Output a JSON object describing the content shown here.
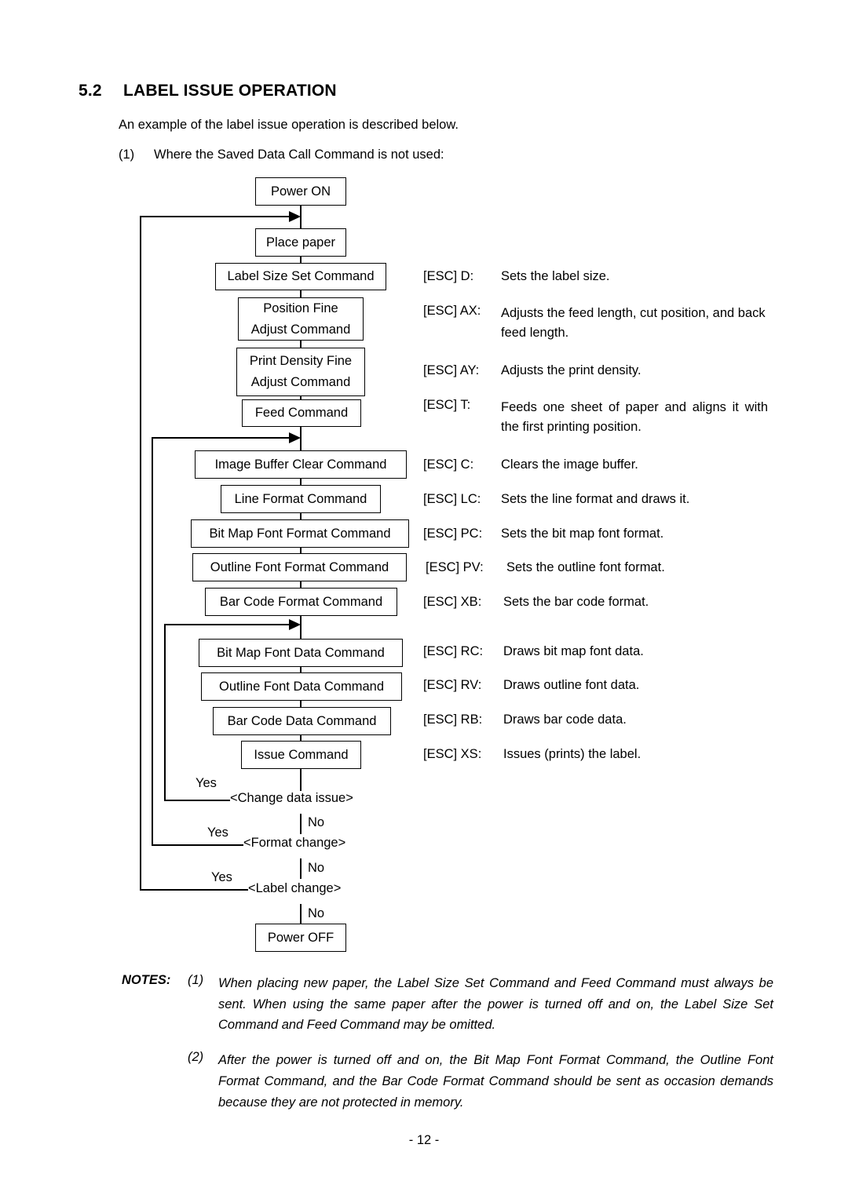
{
  "heading": {
    "number": "5.2",
    "title": "LABEL ISSUE OPERATION"
  },
  "intro": "An example of the label issue operation is described below.",
  "case": {
    "marker": "(1)",
    "text": "Where the Saved Data Call Command is not used:"
  },
  "flowchart": {
    "boxes": [
      {
        "id": "power-on",
        "label": "Power ON"
      },
      {
        "id": "place-paper",
        "label": "Place paper"
      },
      {
        "id": "label-size-set",
        "label": "Label Size Set Command"
      },
      {
        "id": "position-fine-adjust",
        "line1": "Position Fine",
        "line2": "Adjust Command"
      },
      {
        "id": "print-density-fine-adjust",
        "line1": "Print Density Fine",
        "line2": "Adjust Command"
      },
      {
        "id": "feed",
        "label": "Feed Command"
      },
      {
        "id": "image-buffer-clear",
        "label": "Image Buffer Clear Command"
      },
      {
        "id": "line-format",
        "label": "Line Format Command"
      },
      {
        "id": "bit-map-font-format",
        "label": "Bit Map Font Format Command"
      },
      {
        "id": "outline-font-format",
        "label": "Outline Font Format Command"
      },
      {
        "id": "bar-code-format",
        "label": "Bar Code Format Command"
      },
      {
        "id": "bit-map-font-data",
        "label": "Bit Map Font Data Command"
      },
      {
        "id": "outline-font-data",
        "label": "Outline Font Data Command"
      },
      {
        "id": "bar-code-data",
        "label": "Bar Code Data Command"
      },
      {
        "id": "issue",
        "label": "Issue Command"
      },
      {
        "id": "power-off",
        "label": "Power OFF"
      }
    ],
    "decisions": [
      {
        "id": "change-data-issue",
        "label": "<Change data issue>",
        "yes": "Yes",
        "no": "No"
      },
      {
        "id": "format-change",
        "label": "<Format change>",
        "yes": "Yes",
        "no": "No"
      },
      {
        "id": "label-change",
        "label": "<Label change>",
        "yes": "Yes",
        "no": "No"
      }
    ],
    "final_no": "No"
  },
  "commands": [
    {
      "code": "[ESC] D:",
      "desc": "Sets the label size."
    },
    {
      "code": "[ESC] AX:",
      "desc": "Adjusts the feed length, cut position, and back feed length."
    },
    {
      "code": "[ESC] AY:",
      "desc": "Adjusts the print density."
    },
    {
      "code": "[ESC] T:",
      "desc": "Feeds one sheet of paper and aligns it with the first printing position."
    },
    {
      "code": "[ESC] C:",
      "desc": "Clears the image buffer."
    },
    {
      "code": "[ESC] LC:",
      "desc": "Sets the line format and draws it."
    },
    {
      "code": "[ESC] PC:",
      "desc": "Sets the bit map font format."
    },
    {
      "code": "[ESC] PV:",
      "desc": "Sets the outline font format."
    },
    {
      "code": "[ESC] XB:",
      "desc": "Sets the bar code format."
    },
    {
      "code": "[ESC] RC:",
      "desc": "Draws bit map font data."
    },
    {
      "code": "[ESC] RV:",
      "desc": "Draws outline font data."
    },
    {
      "code": "[ESC] RB:",
      "desc": "Draws bar code data."
    },
    {
      "code": "[ESC] XS:",
      "desc": "Issues (prints) the label."
    }
  ],
  "notes": {
    "label": "NOTES:",
    "items": [
      {
        "index": "(1)",
        "text": "When placing new paper, the Label Size Set Command and Feed Command must always be sent.  When using the same paper after the power is turned off and on, the Label Size Set Command and Feed Command may be omitted."
      },
      {
        "index": "(2)",
        "text": "After the power is turned off and on, the Bit Map Font Format Command, the Outline Font Format Command, and the Bar Code Format Command should be sent as occasion demands because they are not protected in memory."
      }
    ]
  },
  "page_number": "- 12 -"
}
